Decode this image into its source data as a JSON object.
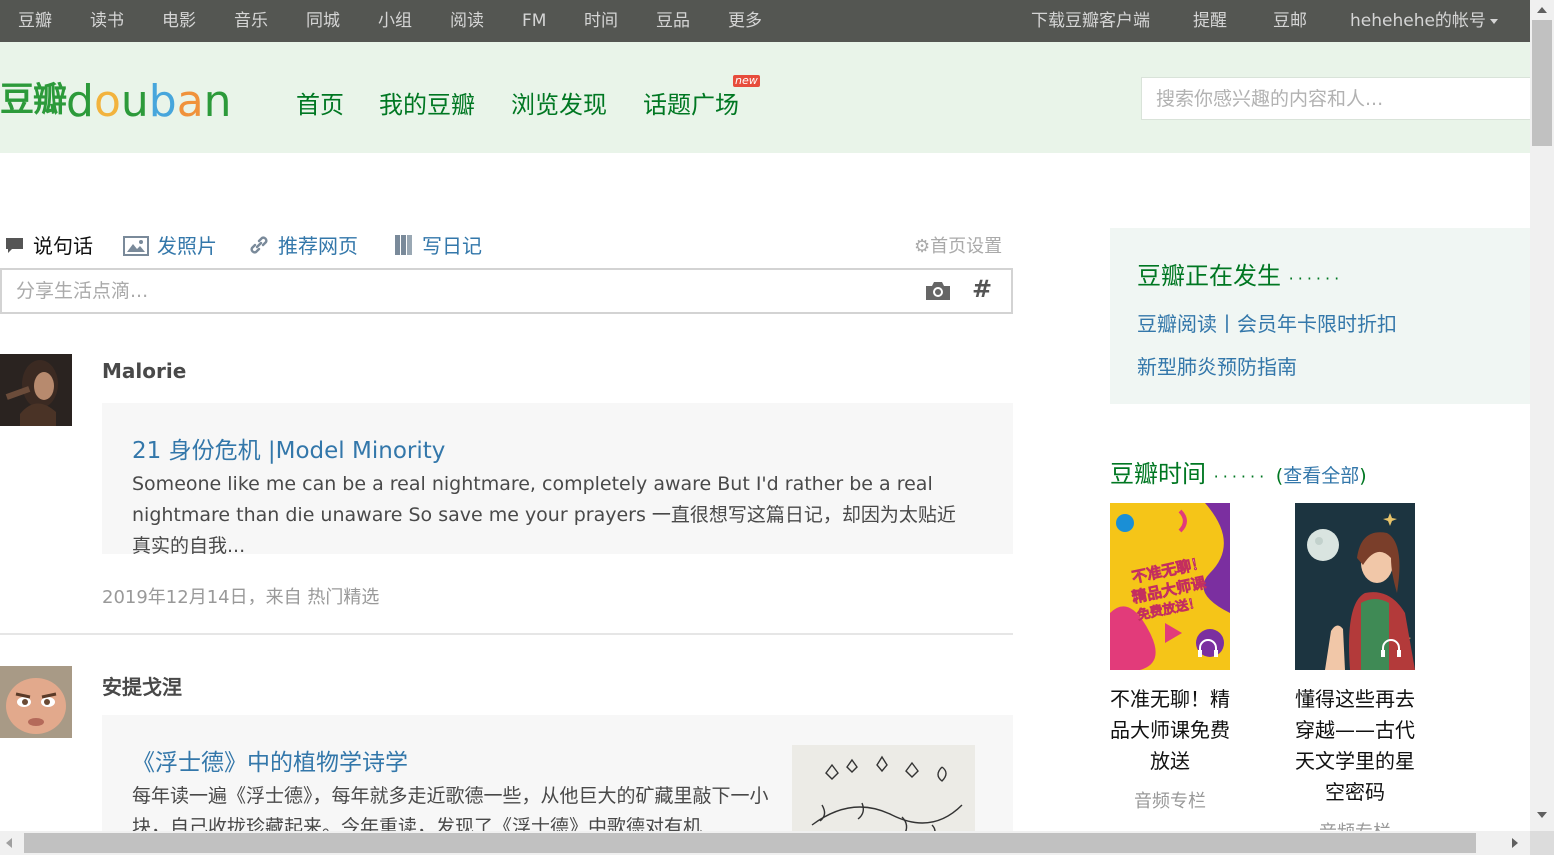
{
  "topbar": {
    "left_items": [
      "豆瓣",
      "读书",
      "电影",
      "音乐",
      "同城",
      "小组",
      "阅读",
      "FM",
      "时间",
      "豆品",
      "更多"
    ],
    "download": "下载豆瓣客户端",
    "remind": "提醒",
    "mail": "豆邮",
    "account": "hehehehe的帐号"
  },
  "header": {
    "logo_cn": "豆瓣",
    "logo_en": "douban",
    "nav": [
      "首页",
      "我的豆瓣",
      "浏览发现",
      "话题广场"
    ],
    "new_badge": "new",
    "search_placeholder": "搜索你感兴趣的内容和人..."
  },
  "share": {
    "tabs": [
      "说句话",
      "发照片",
      "推荐网页",
      "写日记"
    ],
    "settings": "首页设置",
    "placeholder": "分享生活点滴...",
    "hash": "#"
  },
  "feed": [
    {
      "user": "Malorie",
      "title": "21 身份危机 |Model Minority",
      "excerpt": "Someone like me can be a real nightmare, completely aware But I'd rather be a real nightmare than die unaware So save me your prayers 一直很想写这篇日记，却因为太贴近真实的自我...",
      "meta": "2019年12月14日，来自 热门精选"
    },
    {
      "user": "安提戈涅",
      "title": "《浮士德》中的植物学诗学",
      "excerpt": "每年读一遍《浮士德》，每年就多走近歌德一些，从他巨大的矿藏里敲下一小块，自己收拢珍藏起来。今年重读，发现了《浮士德》中歌德对有机"
    }
  ],
  "sidebar": {
    "happening_title": "豆瓣正在发生",
    "happening_dots": "······",
    "happening_links": [
      "豆瓣阅读丨会员年卡限时折扣",
      "新型肺炎预防指南"
    ],
    "time_title": "豆瓣时间",
    "time_dots": "······",
    "time_all": "查看全部",
    "time_paren_open": "(",
    "time_paren_close": ")",
    "books": [
      {
        "title": "不准无聊！精品大师课免费放送",
        "type": "音频专栏",
        "cover_text": "不准无聊！精品大师课免费放送！"
      },
      {
        "title": "懂得这些再去穿越——古代天文学里的星空密码",
        "type": "音频专栏"
      }
    ]
  },
  "colors": {
    "topbar_bg": "#545652",
    "header_bg": "#e9f4e9",
    "brand_green": "#072",
    "link_blue": "#37a"
  },
  "icons": [
    "speech-bubble-icon",
    "picture-icon",
    "link-icon",
    "diary-icon",
    "gear-icon",
    "camera-icon",
    "headphones-icon",
    "caret-down-icon"
  ]
}
